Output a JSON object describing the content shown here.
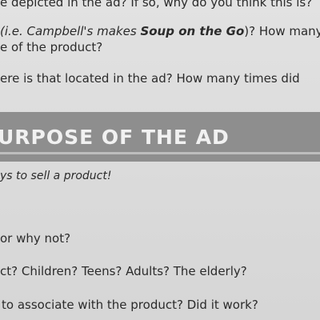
{
  "section1": {
    "line1": "e depicted in the ad? If so, why do you think this is?",
    "line2_pre": "(i.e. Campbell's makes ",
    "line2_bold": "Soup on the Go",
    "line2_post": ")? How many",
    "line3": "e of the product?",
    "line4": "ere is that located in the ad? How many times did"
  },
  "banner": {
    "title": "URPOSE OF THE AD"
  },
  "section2": {
    "subtitle": "ys to sell a product!",
    "q1": "or why not?",
    "q2": "ct? Children? Teens? Adults? The elderly?",
    "q3": "to associate with the product? Did it work?"
  }
}
